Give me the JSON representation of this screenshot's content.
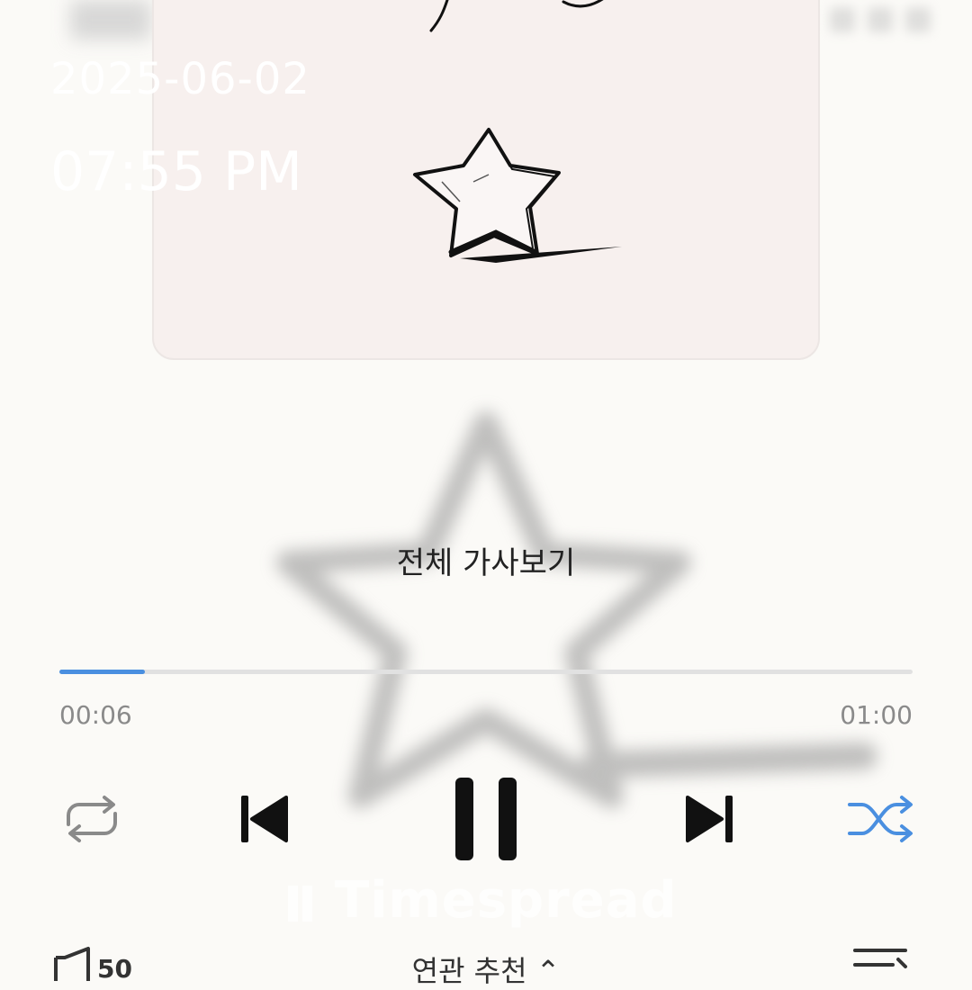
{
  "overlay": {
    "date": "2025-06-02",
    "time": "07:55 PM"
  },
  "lyrics": {
    "full_lyrics_label": "전체 가사보기"
  },
  "progress": {
    "elapsed": "00:06",
    "total": "01:00",
    "fraction": 0.1
  },
  "controls": {
    "repeat_icon": "repeat-icon",
    "previous_icon": "skip-previous-icon",
    "pause_icon": "pause-icon",
    "next_icon": "skip-next-icon",
    "shuffle_icon": "shuffle-icon",
    "shuffle_active": true
  },
  "watermark": {
    "text": "Timespread"
  },
  "bottom_bar": {
    "volume_count": "50",
    "related_label": "연관 추천",
    "playlist_icon": "playlist-icon"
  },
  "colors": {
    "accent": "#4a8fe0",
    "background": "#fbfaf7",
    "album_bg": "#f7f0ee"
  }
}
